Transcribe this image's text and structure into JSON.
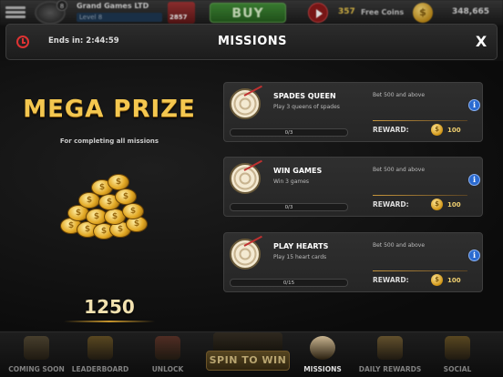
{
  "topbar": {
    "player_name": "Grand Games LTD",
    "player_level": "Level 8",
    "level_badge": "8",
    "gift_count": "2857",
    "buy_label": "BUY",
    "free_coins_count": "357",
    "free_coins_label": "Free Coins",
    "coin_symbol": "$",
    "balance": "348,665"
  },
  "header": {
    "ends_in": "Ends in: 2:44:59",
    "title": "MISSIONS",
    "close_label": "X"
  },
  "mega_prize": {
    "title": "MEGA PRIZE",
    "subtitle": "For completing all missions",
    "amount": "1250",
    "coin_symbol": "$"
  },
  "missions": [
    {
      "name": "SPADES QUEEN",
      "description": "Play 3 queens of spades",
      "condition": "Bet 500 and above",
      "progress_text": "0/3",
      "progress_fraction": 0,
      "reward_label": "REWARD:",
      "coin_symbol": "$",
      "reward_amount": "100",
      "info_label": "i"
    },
    {
      "name": "WIN GAMES",
      "description": "Win 3 games",
      "condition": "Bet 500 and above",
      "progress_text": "0/3",
      "progress_fraction": 0,
      "reward_label": "REWARD:",
      "coin_symbol": "$",
      "reward_amount": "100",
      "info_label": "i"
    },
    {
      "name": "PLAY HEARTS",
      "description": "Play 15 heart cards",
      "condition": "Bet 500 and above",
      "progress_text": "0/15",
      "progress_fraction": 0,
      "reward_label": "REWARD:",
      "coin_symbol": "$",
      "reward_amount": "100",
      "info_label": "i"
    }
  ],
  "bottomnav": {
    "items": [
      {
        "label": "COMING SOON",
        "icon": "trophy-icon",
        "color": "#6a5a3a"
      },
      {
        "label": "LEADERBOARD",
        "icon": "podium-icon",
        "color": "#8a6a24"
      },
      {
        "label": "UNLOCK",
        "icon": "characters-icon",
        "color": "#7a3a2a"
      },
      {
        "label": "MISSIONS",
        "icon": "target-icon",
        "color": "#c8b490"
      },
      {
        "label": "DAILY REWARDS",
        "icon": "gift-icon",
        "color": "#9a7a3a"
      },
      {
        "label": "SOCIAL",
        "icon": "people-icon",
        "color": "#8a6a24"
      }
    ],
    "spin_label": "SPIN TO WIN"
  },
  "colors": {
    "accent_gold": "#f4c74f",
    "buy_green": "#3f8b35",
    "info_blue": "#2a6ad0",
    "timer_red": "#d33333"
  }
}
